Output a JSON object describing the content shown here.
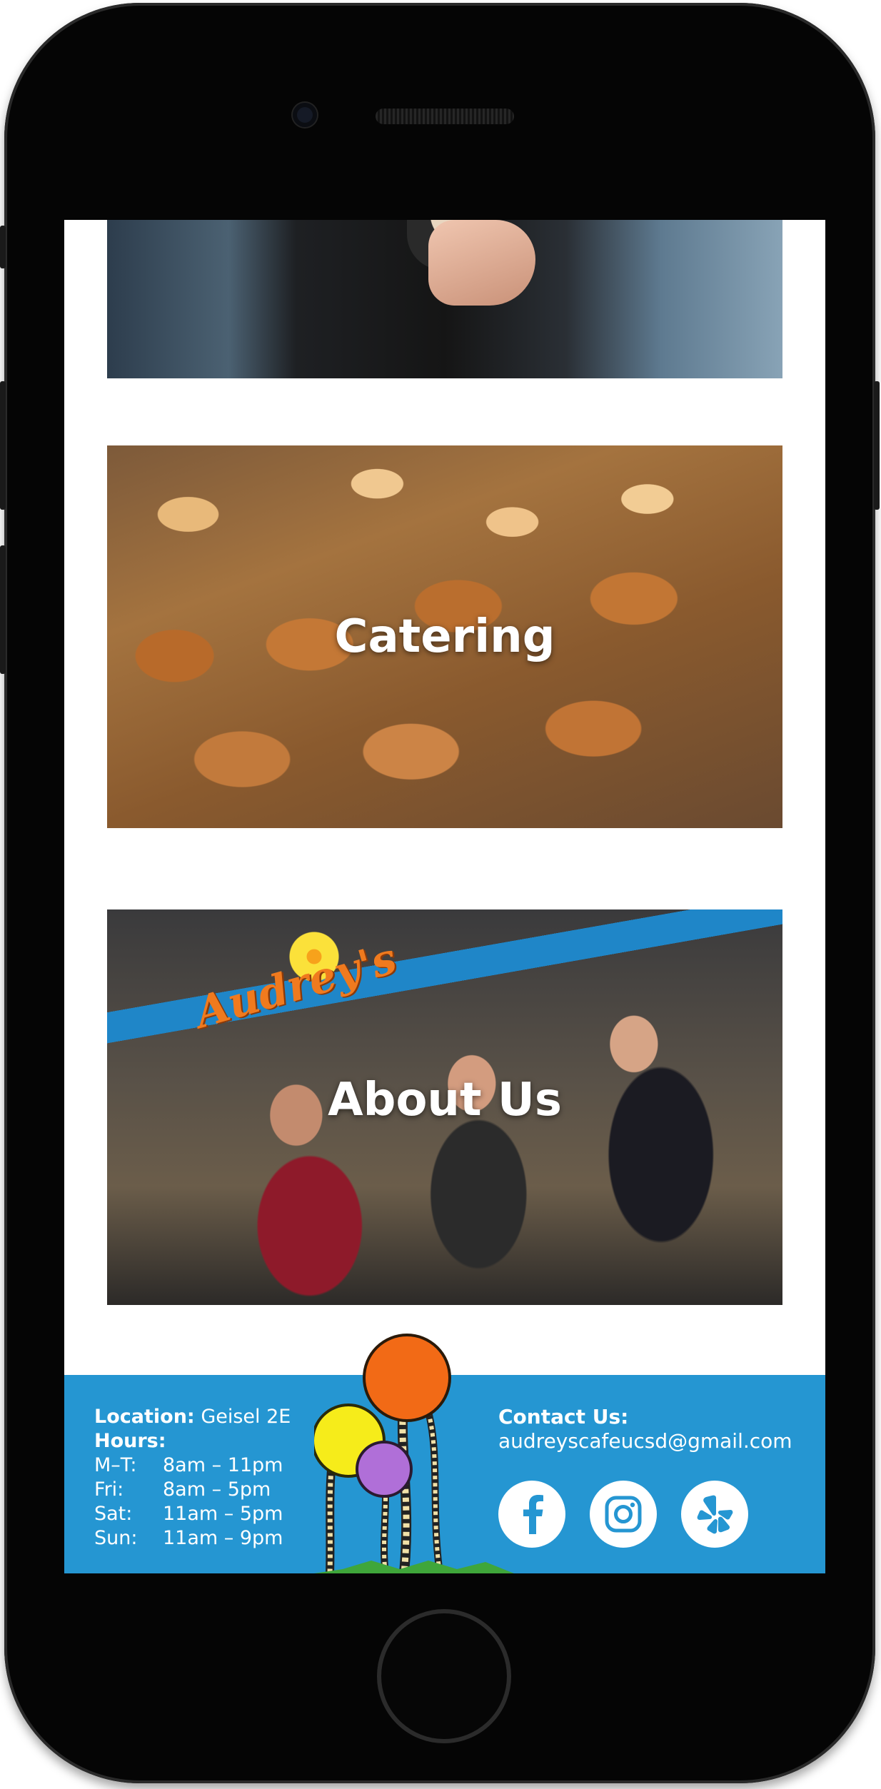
{
  "sections": {
    "catering": {
      "title": "Catering"
    },
    "about": {
      "title": "About Us",
      "brand_sign": "Audrey's"
    }
  },
  "footer": {
    "location_label": "Location:",
    "location_value": "Geisel 2E",
    "hours_label": "Hours:",
    "hours": [
      {
        "day": "M–T:",
        "time": "8am – 11pm"
      },
      {
        "day": "Fri:",
        "time": "8am – 5pm"
      },
      {
        "day": "Sat:",
        "time": "11am – 5pm"
      },
      {
        "day": "Sun:",
        "time": "11am – 9pm"
      }
    ],
    "contact_label": "Contact Us:",
    "contact_email": "audreyscafeucsd@gmail.com",
    "socials": [
      "facebook-icon",
      "instagram-icon",
      "yelp-icon"
    ]
  },
  "colors": {
    "footer_bg": "#2596d2",
    "icon_blue": "#2596d2"
  }
}
